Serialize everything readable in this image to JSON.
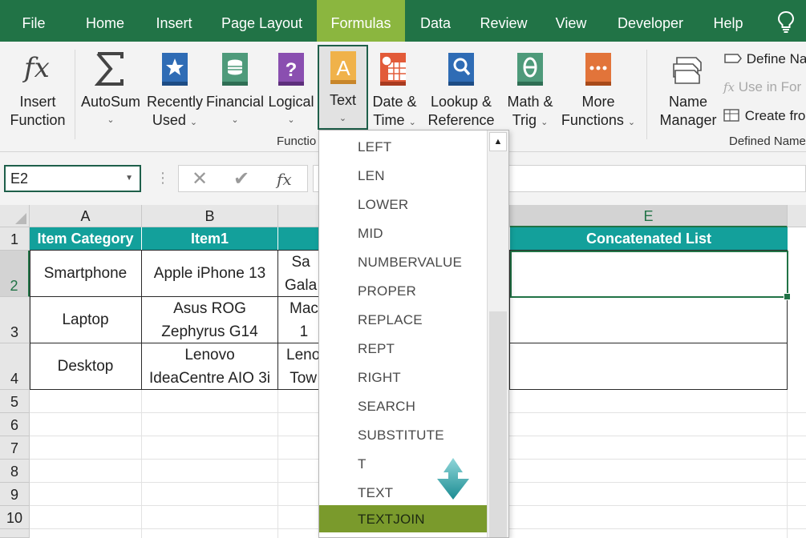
{
  "tabs": [
    {
      "label": "File"
    },
    {
      "label": "Home"
    },
    {
      "label": "Insert"
    },
    {
      "label": "Page Layout"
    },
    {
      "label": "Formulas",
      "active": true
    },
    {
      "label": "Data"
    },
    {
      "label": "Review"
    },
    {
      "label": "View"
    },
    {
      "label": "Developer"
    },
    {
      "label": "Help"
    }
  ],
  "ribbon": {
    "insert_function": {
      "line1": "Insert",
      "line2": "Function",
      "icon": "fx-icon"
    },
    "autosum": {
      "line1": "AutoSum",
      "chevron": "⌄",
      "icon": "sigma-icon"
    },
    "recently_used": {
      "line1": "Recently",
      "line2": "Used",
      "chevron": "⌄",
      "icon": "star-book-icon"
    },
    "financial": {
      "line1": "Financial",
      "chevron": "⌄",
      "icon": "coins-book-icon"
    },
    "logical": {
      "line1": "Logical",
      "chevron": "⌄",
      "icon": "question-book-icon"
    },
    "text": {
      "line1": "Text",
      "chevron": "⌄",
      "icon": "letter-a-book-icon"
    },
    "date_time": {
      "line1": "Date &",
      "line2": "Time",
      "chevron": "⌄",
      "icon": "calendar-book-icon"
    },
    "lookup": {
      "line1": "Lookup &",
      "line2": "Reference",
      "chevron": "⌄",
      "icon": "magnifier-book-icon"
    },
    "math_trig": {
      "line1": "Math &",
      "line2": "Trig",
      "chevron": "⌄",
      "icon": "theta-book-icon"
    },
    "more_functions": {
      "line1": "More",
      "line2": "Functions",
      "chevron": "⌄",
      "icon": "ellipsis-book-icon"
    },
    "name_manager": {
      "line1": "Name",
      "line2": "Manager",
      "icon": "name-tags-icon"
    },
    "define_name": "Define Na",
    "use_in_formula": "Use in For",
    "create_from": "Create fro",
    "group_function_library": "Functio",
    "group_defined_names": "Defined Name"
  },
  "formula_bar": {
    "name_box": "E2",
    "cancel": "✕",
    "enter": "✔",
    "fx": "fx",
    "value": ""
  },
  "sheet": {
    "columns": [
      "A",
      "B",
      "E"
    ],
    "rows": [
      "1",
      "2",
      "3",
      "4",
      "5",
      "6",
      "7",
      "8",
      "9",
      "10"
    ],
    "header": {
      "a": "Item Category",
      "b": "Item1",
      "e": "Concatenated List"
    },
    "data": [
      {
        "a": "Smartphone",
        "b": "Apple iPhone 13",
        "c": "Sa\nGala"
      },
      {
        "a": "Laptop",
        "b": "Asus ROG\nZephyrus G14",
        "c": "Mac\n1"
      },
      {
        "a": "Desktop",
        "b": "Lenovo\nIdeaCentre AIO 3i",
        "c": "Leno\nTow"
      }
    ]
  },
  "text_menu": {
    "items": [
      "LEFT",
      "LEN",
      "LOWER",
      "MID",
      "NUMBERVALUE",
      "PROPER",
      "REPLACE",
      "REPT",
      "RIGHT",
      "SEARCH",
      "SUBSTITUTE",
      "T",
      "TEXT",
      "TEXTJOIN"
    ],
    "highlighted": "TEXTJOIN",
    "scroll_up": "▲"
  },
  "colors": {
    "tab_bar": "#217346",
    "active_tab": "#8bb63f",
    "header_fill": "#13a09b",
    "menu_highlight": "#7a9a2c",
    "callout_arrow": "#1b9aa0"
  }
}
